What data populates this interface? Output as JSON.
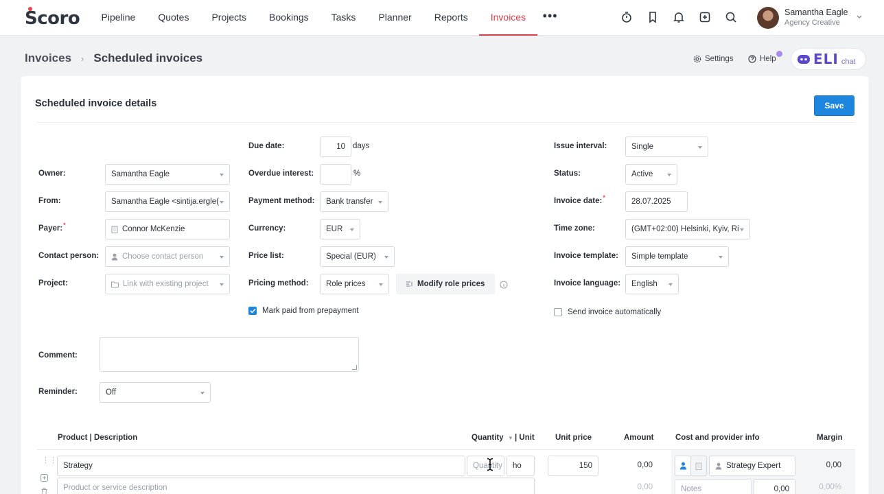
{
  "brand": {
    "logo_text": "Scoro"
  },
  "nav": {
    "items": [
      {
        "label": "Pipeline"
      },
      {
        "label": "Quotes"
      },
      {
        "label": "Projects"
      },
      {
        "label": "Bookings"
      },
      {
        "label": "Tasks"
      },
      {
        "label": "Planner"
      },
      {
        "label": "Reports"
      },
      {
        "label": "Invoices",
        "active": true
      }
    ],
    "more_label": "•••",
    "accent": "#d8414c"
  },
  "top_icons": [
    "timer-icon",
    "bookmark-icon",
    "bell-icon",
    "add-square-icon",
    "search-icon"
  ],
  "user": {
    "name": "Samantha Eagle",
    "org": "Agency Creative"
  },
  "breadcrumb": {
    "root": "Invoices",
    "current": "Scheduled invoices"
  },
  "header_links": {
    "settings": "Settings",
    "help": "Help"
  },
  "eli": {
    "name": "ELI",
    "suffix": "chat"
  },
  "card": {
    "title": "Scheduled invoice details",
    "save_label": "Save",
    "save_color": "#1f86e0"
  },
  "form": {
    "owner": {
      "label": "Owner:",
      "value": "Samantha Eagle"
    },
    "from": {
      "label": "From:",
      "value": "Samantha Eagle <sintija.ergle("
    },
    "payer": {
      "label": "Payer:",
      "required": "*",
      "value": "Connor McKenzie"
    },
    "contact_person": {
      "label": "Contact person:",
      "placeholder": "Choose contact person"
    },
    "project": {
      "label": "Project:",
      "placeholder": "Link with existing project"
    },
    "due_date": {
      "label": "Due date:",
      "value": "10",
      "suffix": "days"
    },
    "overdue_interest": {
      "label": "Overdue interest:",
      "value": "",
      "suffix": "%"
    },
    "payment_method": {
      "label": "Payment method:",
      "value": "Bank transfer"
    },
    "currency": {
      "label": "Currency:",
      "value": "EUR"
    },
    "price_list": {
      "label": "Price list:",
      "value": "Special (EUR)"
    },
    "pricing_method": {
      "label": "Pricing method:",
      "value": "Role prices"
    },
    "modify_role_prices": "Modify role prices",
    "mark_paid": {
      "label": "Mark paid from prepayment",
      "checked": true
    },
    "issue_interval": {
      "label": "Issue interval:",
      "value": "Single"
    },
    "status": {
      "label": "Status:",
      "value": "Active"
    },
    "invoice_date": {
      "label": "Invoice date:",
      "required": "*",
      "value": "28.07.2025"
    },
    "time_zone": {
      "label": "Time zone:",
      "value": "(GMT+02:00) Helsinki, Kyiv, Ri"
    },
    "invoice_template": {
      "label": "Invoice template:",
      "value": "Simple template"
    },
    "invoice_language": {
      "label": "Invoice language:",
      "value": "English"
    },
    "send_auto": {
      "label": "Send invoice automatically",
      "checked": false
    },
    "comment": {
      "label": "Comment:"
    },
    "reminder": {
      "label": "Reminder:",
      "value": "Off"
    }
  },
  "table": {
    "headers": {
      "product": "Product | Description",
      "quantity": "Quantity",
      "unit": "| Unit",
      "unit_price": "Unit price",
      "amount": "Amount",
      "cost": "Cost and provider info",
      "margin": "Margin"
    },
    "rows": [
      {
        "product": "Strategy",
        "description_placeholder": "Product or service description",
        "quantity_placeholder": "Quantity",
        "unit": "ho",
        "unit_price": "150",
        "amount": "0,00",
        "amount_secondary": "0,00",
        "provider": "Strategy Expert",
        "notes_placeholder": "Notes",
        "cost_value": "0,00",
        "margin": "0,00",
        "margin_percent": "0,00%"
      }
    ]
  }
}
